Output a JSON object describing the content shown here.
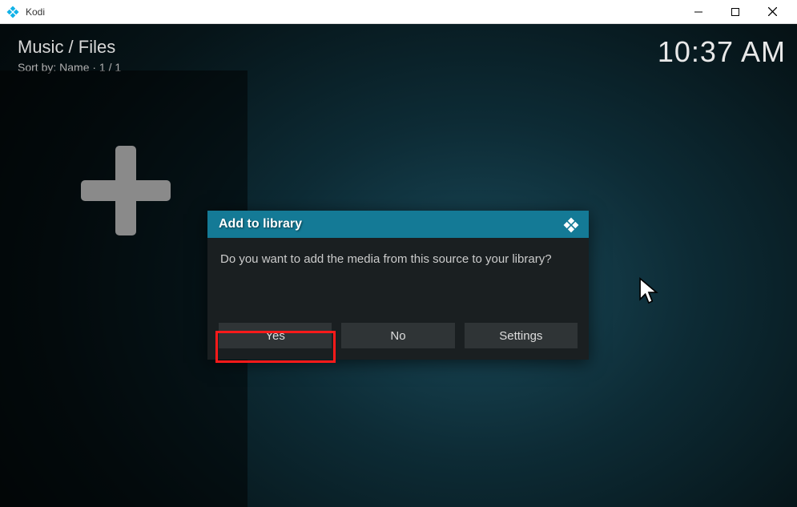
{
  "window": {
    "title": "Kodi"
  },
  "header": {
    "breadcrumb": "Music / Files",
    "sort": "Sort by: Name  ·  1 / 1",
    "clock": "10:37 AM"
  },
  "dialog": {
    "title": "Add to library",
    "message": "Do you want to add the media from this source to your library?",
    "buttons": {
      "yes": "Yes",
      "no": "No",
      "settings": "Settings"
    }
  }
}
